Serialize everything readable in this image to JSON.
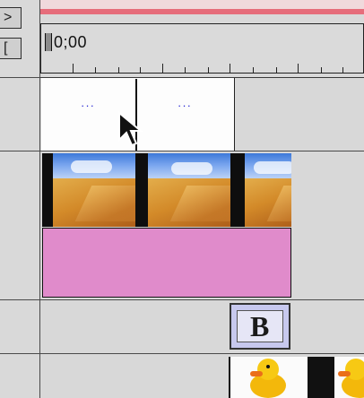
{
  "ruler": {
    "timecode": "0;00"
  },
  "side_buttons": {
    "top_icon": "expand-track-icon",
    "second_icon": "bracket-icon"
  },
  "title_track": {
    "placeholder_1": "···",
    "placeholder_2": "···"
  },
  "b_clip": {
    "letter": "B"
  },
  "colors": {
    "ruler_red": "#e66d7b",
    "pink_clip": "#e08bcb",
    "b_clip": "#c7c8ee"
  },
  "icons": {
    "cursor": "arrow-cursor-icon",
    "video_thumb": "desert-thumbnail-icon",
    "duck_thumb": "duck-thumbnail-icon"
  }
}
